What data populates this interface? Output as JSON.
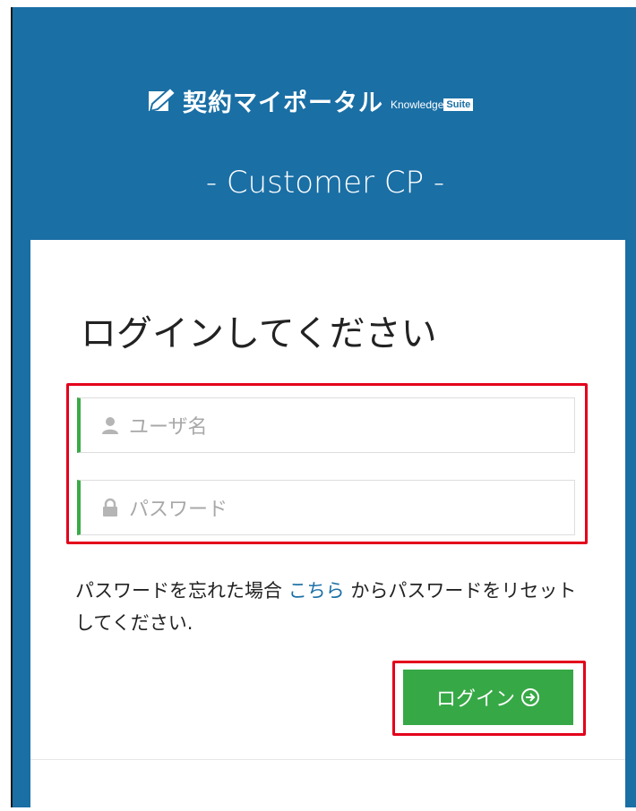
{
  "brand": {
    "title": "契約マイポータル",
    "sub": "Knowledge",
    "suite": "Suite"
  },
  "subtitle": "- Customer CP -",
  "login": {
    "heading": "ログインしてください",
    "username_placeholder": "ユーザ名",
    "password_placeholder": "パスワード",
    "note_prefix": "パスワードを忘れた場合",
    "note_link": "こちら",
    "note_suffix": "からパスワードをリセットしてください.",
    "button_label": "ログイン"
  },
  "colors": {
    "header_bg": "#1a6fa5",
    "accent_green": "#37a846",
    "highlight_red": "#e3001b"
  },
  "icons": {
    "brand": "pen-check-icon",
    "username": "user-icon",
    "password": "lock-icon",
    "login_arrow": "circle-arrow-right-icon"
  }
}
